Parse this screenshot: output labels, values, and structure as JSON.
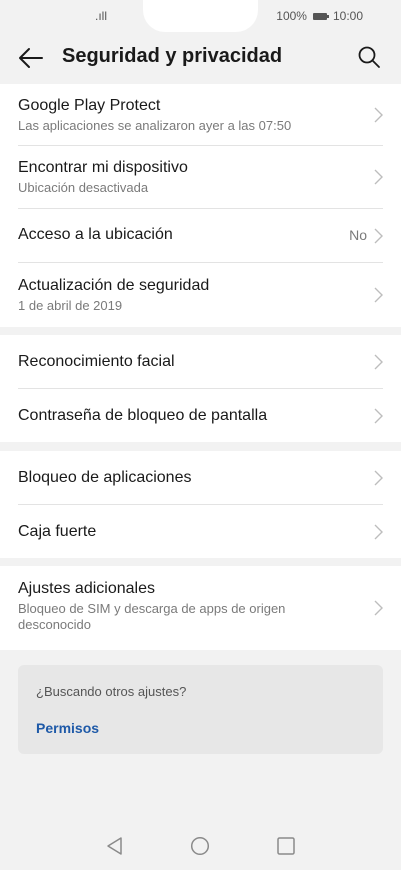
{
  "status_bar": {
    "signal": ".ıll",
    "battery_text": "100%",
    "time": "10:00"
  },
  "header": {
    "title": "Seguridad y privacidad",
    "back_icon": "arrow-left-icon",
    "search_icon": "search-icon"
  },
  "groups": [
    {
      "items": [
        {
          "label": "Google Play Protect",
          "sub": "Las aplicaciones se analizaron ayer a las 07:50"
        },
        {
          "label": "Encontrar mi dispositivo",
          "sub": "Ubicación desactivada"
        },
        {
          "label": "Acceso a la ubicación",
          "value": "No"
        },
        {
          "label": "Actualización de seguridad",
          "sub": "1 de abril de 2019"
        }
      ]
    },
    {
      "items": [
        {
          "label": "Reconocimiento facial"
        },
        {
          "label": "Contraseña de bloqueo de pantalla"
        }
      ]
    },
    {
      "items": [
        {
          "label": "Bloqueo de aplicaciones"
        },
        {
          "label": "Caja fuerte"
        }
      ]
    },
    {
      "items": [
        {
          "label": "Ajustes adicionales",
          "sub": "Bloqueo de SIM y descarga de apps de origen desconocido"
        }
      ]
    }
  ],
  "suggestion_card": {
    "title": "¿Buscando otros ajustes?",
    "link": "Permisos"
  },
  "navigation_bar": {
    "buttons": [
      "back-triangle-icon",
      "home-circle-icon",
      "recents-square-icon"
    ]
  },
  "colors": {
    "background": "#f2f2f2",
    "surface": "#ffffff",
    "link": "#1f5aa8",
    "secondary_text": "#7a7a7a"
  }
}
